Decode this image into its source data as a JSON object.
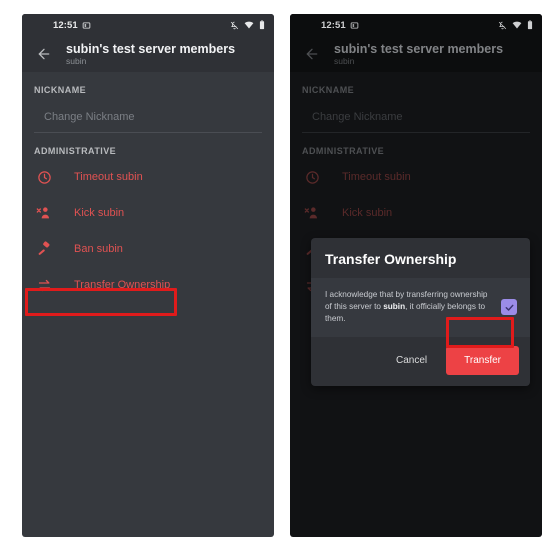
{
  "accent": {
    "danger": "#ed4245",
    "danger_text": "#e05252",
    "blurple": "#9b8ce8",
    "annotation": "#e01b1b",
    "panel_bg": "#36393e",
    "header_bg": "#2f3136",
    "dim_panel_bg": "#111214"
  },
  "panels": [
    {
      "id": "left",
      "statusbar": {
        "time": "12:51",
        "time_icon": "screenshot-icon",
        "icons": [
          "vibrate-off-icon",
          "wifi-icon",
          "battery-icon"
        ]
      },
      "header": {
        "back_icon": "back-arrow-icon",
        "title": "subin's test server members",
        "subtitle": "subin"
      },
      "sections": [
        {
          "label": "NICKNAME",
          "input": {
            "placeholder": "Change Nickname",
            "value": ""
          }
        },
        {
          "label": "ADMINISTRATIVE",
          "rows": [
            {
              "icon": "clock-icon",
              "label": "Timeout subin",
              "highlighted": false
            },
            {
              "icon": "kick-user-icon",
              "label": "Kick subin",
              "highlighted": false
            },
            {
              "icon": "hammer-icon",
              "label": "Ban subin",
              "highlighted": false
            },
            {
              "icon": "transfer-icon",
              "label": "Transfer Ownership",
              "highlighted": true
            }
          ]
        }
      ],
      "modal": null
    },
    {
      "id": "right",
      "statusbar": {
        "time": "12:51",
        "time_icon": "screenshot-icon",
        "icons": [
          "vibrate-off-icon",
          "wifi-icon",
          "battery-icon"
        ]
      },
      "header": {
        "back_icon": "back-arrow-icon",
        "title": "subin's test server members",
        "subtitle": "subin"
      },
      "sections": [
        {
          "label": "NICKNAME",
          "input": {
            "placeholder": "Change Nickname",
            "value": ""
          }
        },
        {
          "label": "ADMINISTRATIVE",
          "rows": [
            {
              "icon": "clock-icon",
              "label": "Timeout subin",
              "highlighted": false
            },
            {
              "icon": "kick-user-icon",
              "label": "Kick subin",
              "highlighted": false
            },
            {
              "icon": "hammer-icon",
              "label": "Ban subin",
              "highlighted": false
            },
            {
              "icon": "transfer-icon",
              "label": "Transfer Ownership",
              "highlighted": false
            }
          ]
        }
      ],
      "modal": {
        "title": "Transfer Ownership",
        "body_prefix": "I acknowledge that by transferring ownership of this server to ",
        "body_bold": "subin",
        "body_suffix": ", it officially belongs to them.",
        "checkbox_checked": true,
        "cancel_label": "Cancel",
        "confirm_label": "Transfer"
      }
    }
  ],
  "annotations": [
    {
      "name": "transfer-ownership-row-highlight",
      "target": "left.transfer-ownership-row"
    },
    {
      "name": "transfer-button-highlight",
      "target": "right.modal.transfer-button"
    }
  ]
}
